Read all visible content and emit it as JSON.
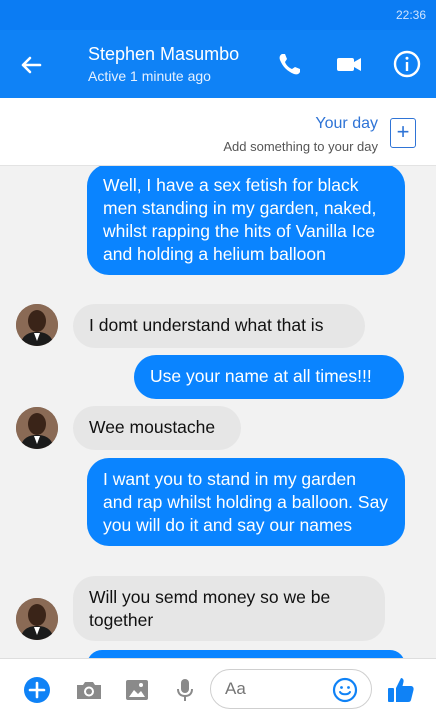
{
  "status_bar": {
    "time": "22:36"
  },
  "header": {
    "contact_name": "Stephen Masumbo",
    "status": "Active 1 minute ago",
    "icons": [
      "back-arrow-icon",
      "phone-icon",
      "video-camera-icon",
      "info-icon"
    ]
  },
  "your_day": {
    "title": "Your day",
    "subtitle": "Add something to your day",
    "add_symbol": "+"
  },
  "messages": [
    {
      "direction": "outgoing",
      "text": "Well, I have a sex fetish for black men standing in my garden, naked, whilst rapping the hits of Vanilla Ice and holding a helium balloon"
    },
    {
      "direction": "incoming",
      "text": "I domt understand what that is"
    },
    {
      "direction": "outgoing",
      "text": "Use your name at all times!!!"
    },
    {
      "direction": "incoming",
      "text": "Wee moustache"
    },
    {
      "direction": "outgoing",
      "text": "I want you to stand in my garden and rap whilst holding a balloon. Say you will do it and say our names"
    },
    {
      "direction": "incoming",
      "text": "Will you semd money so we be together"
    }
  ],
  "composer": {
    "placeholder": "Aa",
    "icons": [
      "plus-icon",
      "camera-icon",
      "image-icon",
      "microphone-icon",
      "emoji-icon",
      "thumbs-up-icon"
    ]
  },
  "colors": {
    "header": "#0f82f6",
    "outgoing_bubble": "#0a84ff",
    "incoming_bubble": "#e6e6e6",
    "accent": "#2f74d6"
  }
}
